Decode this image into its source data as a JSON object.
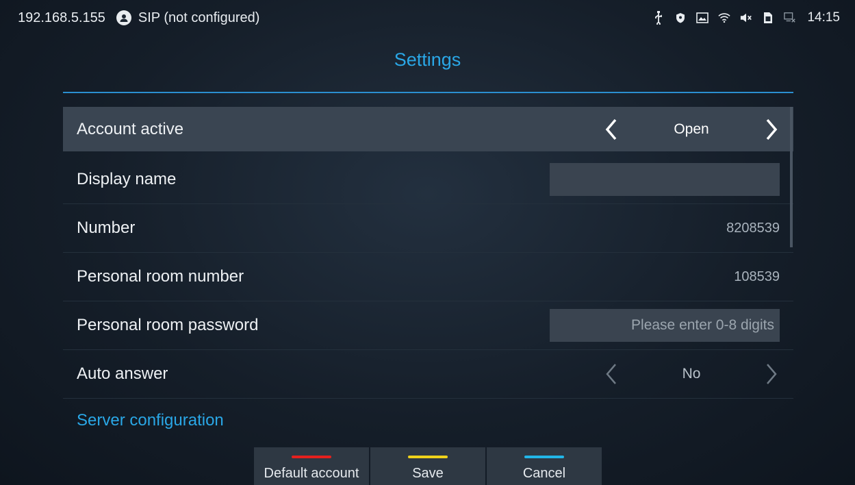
{
  "statusbar": {
    "ip": "192.168.5.155",
    "account_status": "SIP (not configured)",
    "time": "14:15",
    "icons": [
      "usb-icon",
      "shield-icon",
      "screenshot-icon",
      "wifi-icon",
      "mute-icon",
      "sim-icon",
      "network-disconnected-icon"
    ]
  },
  "page": {
    "title": "Settings"
  },
  "rows": {
    "account_active": {
      "label": "Account active",
      "value": "Open"
    },
    "display_name": {
      "label": "Display name",
      "value": ""
    },
    "number": {
      "label": "Number",
      "value": "8208539"
    },
    "personal_room_number": {
      "label": "Personal room number",
      "value": "108539"
    },
    "personal_room_password": {
      "label": "Personal room password",
      "placeholder": "Please enter 0-8 digits"
    },
    "auto_answer": {
      "label": "Auto answer",
      "value": "No"
    }
  },
  "section_link": "Server configuration",
  "softkeys": [
    {
      "label": "Default account",
      "color": "#e5201e"
    },
    {
      "label": "Save",
      "color": "#f0d21b"
    },
    {
      "label": "Cancel",
      "color": "#22b6e8"
    }
  ],
  "colors": {
    "accent": "#2aa7e6",
    "active_row": "#3a4552"
  }
}
